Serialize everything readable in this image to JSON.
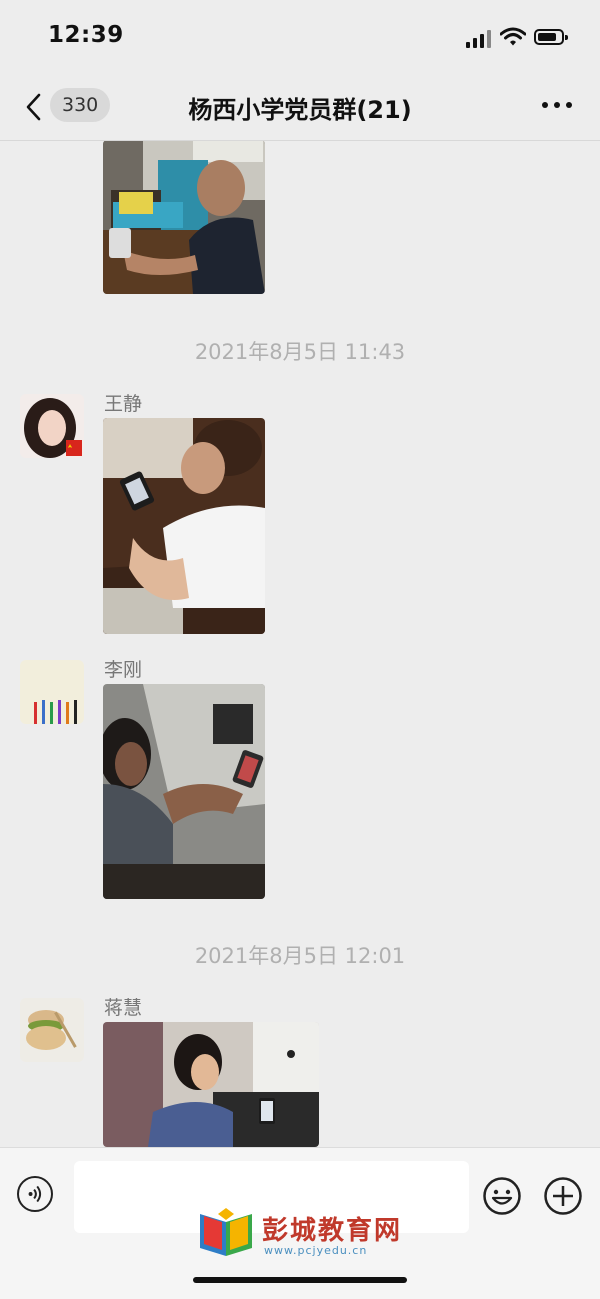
{
  "status_bar": {
    "time": "12:39"
  },
  "nav": {
    "back_count": "330",
    "title": "杨西小学党员群(21)"
  },
  "messages": [
    {
      "timestamp": "2021年8月5日 11:43",
      "sender": "王静"
    },
    {
      "sender": "李刚"
    },
    {
      "timestamp": "2021年8月5日 12:01",
      "sender": "蒋慧"
    }
  ],
  "watermark": {
    "text": "彭城教育网",
    "url": "www.pcjyedu.cn"
  },
  "colors": {
    "background": "#ededed",
    "input_bar": "#f5f5f5",
    "accent_red": "#c0392b"
  }
}
